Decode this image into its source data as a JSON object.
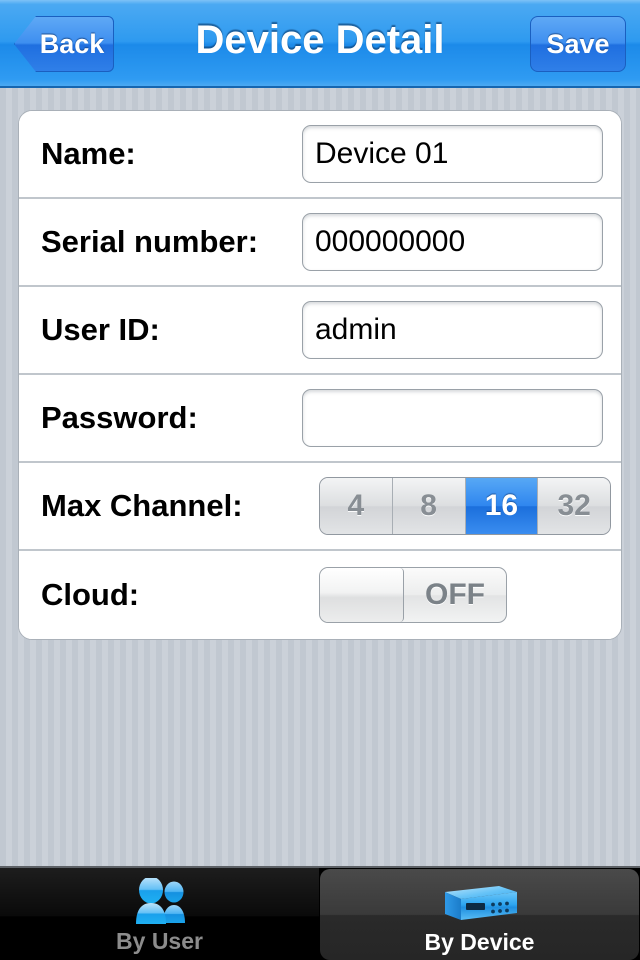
{
  "navbar": {
    "title": "Device Detail",
    "back_label": "Back",
    "save_label": "Save",
    "back_icon": "chevron-left-icon",
    "accent_color": "#2e9af0"
  },
  "form": {
    "rows": [
      {
        "key": "name",
        "label": "Name:",
        "control": "text",
        "value": "Device 01",
        "placeholder": ""
      },
      {
        "key": "serial_number",
        "label": "Serial number:",
        "control": "text",
        "value": "000000000",
        "placeholder": ""
      },
      {
        "key": "user_id",
        "label": "User ID:",
        "control": "text",
        "value": "admin",
        "placeholder": ""
      },
      {
        "key": "password",
        "label": "Password:",
        "control": "text",
        "value": "",
        "placeholder": ""
      },
      {
        "key": "max_channel",
        "label": "Max Channel:",
        "control": "segmented",
        "options": [
          "4",
          "8",
          "16",
          "32"
        ],
        "selected": "16",
        "selected_color": "#2f86ef"
      },
      {
        "key": "cloud",
        "label": "Cloud:",
        "control": "switch",
        "state_label": "OFF",
        "on": false
      }
    ]
  },
  "tabbar": {
    "tabs": [
      {
        "key": "by_user",
        "label": "By User",
        "icon": "two-people-icon",
        "selected": false
      },
      {
        "key": "by_device",
        "label": "By Device",
        "icon": "dvr-device-icon",
        "selected": true
      }
    ],
    "icon_color": "#29a9f0"
  }
}
